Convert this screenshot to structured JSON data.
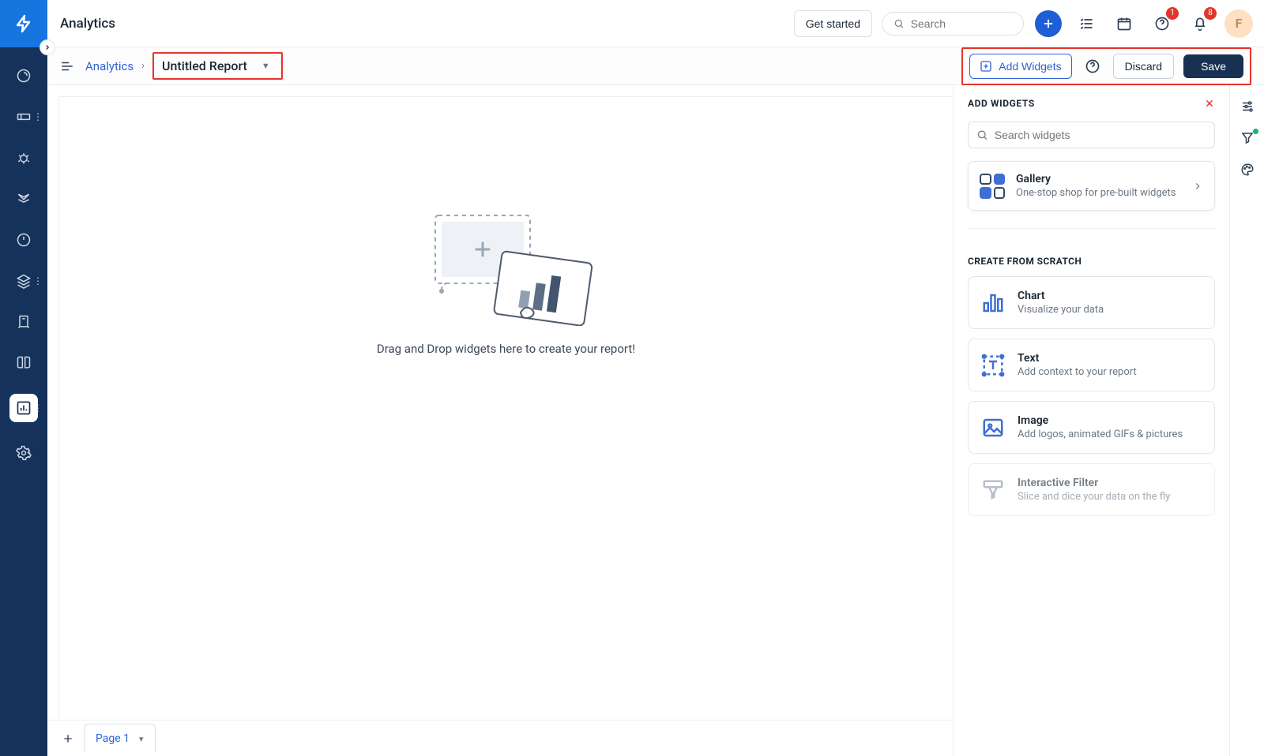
{
  "header": {
    "app_title": "Analytics",
    "get_started": "Get started",
    "search_placeholder": "Search",
    "help_badge": "1",
    "bell_badge": "8",
    "avatar_initial": "F"
  },
  "subbar": {
    "crumb_root": "Analytics",
    "crumb_current": "Untitled Report",
    "add_widgets": "Add Widgets",
    "discard": "Discard",
    "save": "Save"
  },
  "canvas": {
    "empty_text": "Drag and Drop widgets here to create your report!"
  },
  "page_tabs": {
    "tab1": "Page 1"
  },
  "panel": {
    "title": "ADD WIDGETS",
    "search_placeholder": "Search widgets",
    "gallery_title": "Gallery",
    "gallery_sub": "One-stop shop for pre-built widgets",
    "scratch_label": "CREATE FROM SCRATCH",
    "widgets": {
      "chart_title": "Chart",
      "chart_sub": "Visualize your data",
      "text_title": "Text",
      "text_sub": "Add context to your report",
      "image_title": "Image",
      "image_sub": "Add logos, animated GIFs & pictures",
      "filter_title": "Interactive Filter",
      "filter_sub": "Slice and dice your data on the fly"
    }
  }
}
